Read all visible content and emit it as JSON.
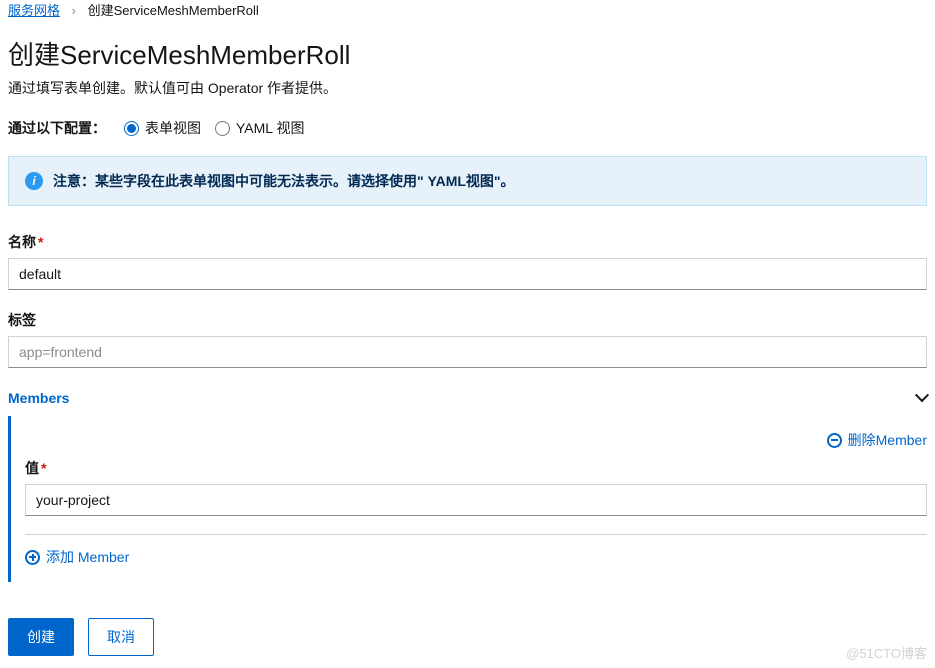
{
  "breadcrumb": {
    "parent": "服务网格",
    "current": "创建ServiceMeshMemberRoll"
  },
  "page": {
    "title": "创建ServiceMeshMemberRoll",
    "description": "通过填写表单创建。默认值可由 Operator 作者提供。"
  },
  "config": {
    "label": "通过以下配置：",
    "form_view": "表单视图",
    "yaml_view": "YAML 视图"
  },
  "alert": {
    "text": "注意：某些字段在此表单视图中可能无法表示。请选择使用\" YAML视图\"。"
  },
  "fields": {
    "name": {
      "label": "名称",
      "value": "default"
    },
    "labels": {
      "label": "标签",
      "value": "",
      "placeholder": "app=frontend"
    }
  },
  "members": {
    "header": "Members",
    "remove_label": "删除Member",
    "add_label": "添加 Member",
    "value_label": "值",
    "items": [
      {
        "value": "your-project"
      }
    ]
  },
  "actions": {
    "create": "创建",
    "cancel": "取消"
  },
  "watermark": "@51CTO博客"
}
